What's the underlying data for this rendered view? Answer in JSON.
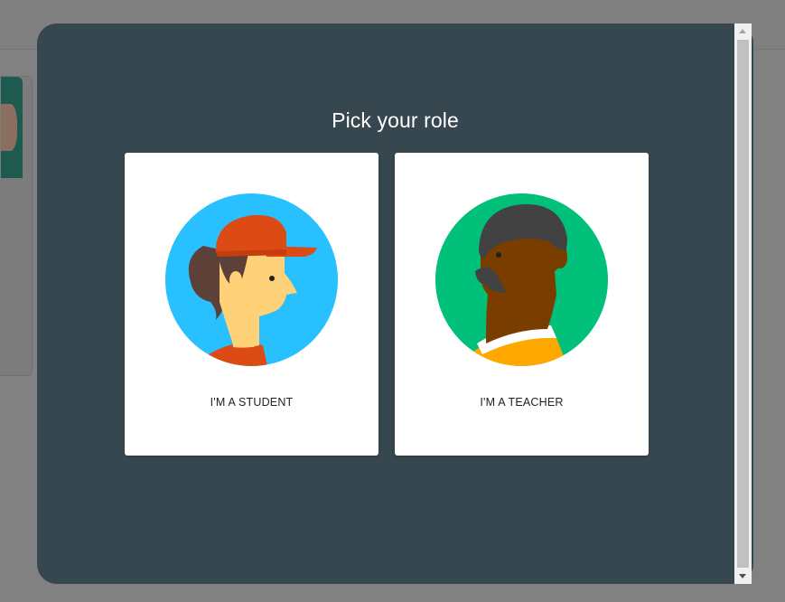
{
  "dialog": {
    "title": "Pick your role",
    "roles": [
      {
        "label": "I'M A STUDENT",
        "avatar_color": "#29c0ff"
      },
      {
        "label": "I'M A TEACHER",
        "avatar_color": "#00c07a"
      }
    ]
  },
  "colors": {
    "modal_background": "#37474f",
    "card_background": "#ffffff",
    "backdrop": "#808080"
  }
}
